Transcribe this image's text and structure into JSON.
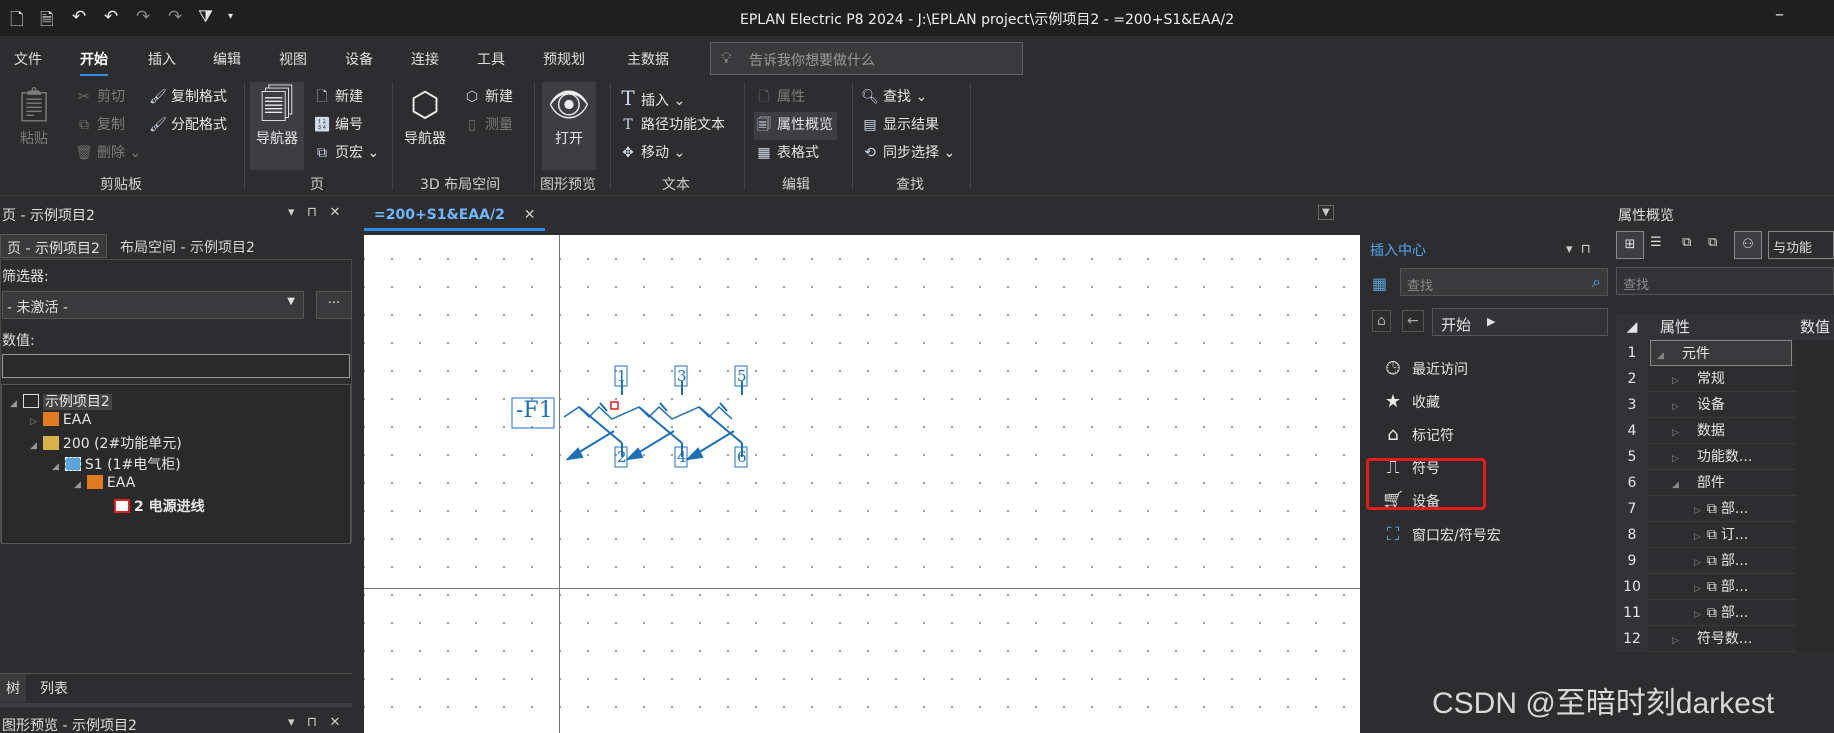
{
  "window": {
    "title": "EPLAN Electric P8 2024 - J:\\EPLAN project\\示例项目2 - =200+S1&EAA/2",
    "minimize": "–"
  },
  "ribbon_tabs": [
    "文件",
    "开始",
    "插入",
    "编辑",
    "视图",
    "设备",
    "连接",
    "工具",
    "预规划",
    "主数据"
  ],
  "active_tab": "开始",
  "tell_me": {
    "placeholder": "告诉我你想要做什么"
  },
  "groups": {
    "clipboard": {
      "label": "剪贴板",
      "paste": "粘贴",
      "cut": "剪切",
      "copy": "复制",
      "delete": "删除",
      "copy_format": "复制格式",
      "distribute_format": "分配格式"
    },
    "page": {
      "label": "页",
      "navigator": "导航器",
      "new": "新建",
      "number": "编号",
      "page_macro": "页宏"
    },
    "layout3d": {
      "label": "3D 布局空间",
      "navigator": "导航器",
      "new": "新建",
      "measure": "测量"
    },
    "preview": {
      "label": "图形预览",
      "open": "打开"
    },
    "text": {
      "label": "文本",
      "insert": "插入",
      "path_text": "路径功能文本",
      "move": "移动"
    },
    "edit": {
      "label": "编辑",
      "properties": "属性",
      "overview": "属性概览",
      "table_format": "表格式"
    },
    "find": {
      "label": "查找",
      "find": "查找",
      "show_results": "显示结果",
      "sync_select": "同步选择"
    }
  },
  "left_panel": {
    "title": "页 - 示例项目2",
    "tabs": [
      "页 - 示例项目2",
      "布局空间 - 示例项目2"
    ],
    "filter_label": "筛选器:",
    "filter_value": "- 未激活 -",
    "filter_more": "...",
    "value_label": "数值:",
    "value_input": "",
    "tree": [
      {
        "label": "示例项目2",
        "level": 0,
        "icon": "project-icon"
      },
      {
        "label": "EAA",
        "level": 1,
        "icon": "location-icon"
      },
      {
        "label": "200 (2#功能单元)",
        "level": 1,
        "icon": "function-icon"
      },
      {
        "label": "S1 (1#电气柜)",
        "level": 2,
        "icon": "cabinet-icon"
      },
      {
        "label": "EAA",
        "level": 3,
        "icon": "location-icon"
      },
      {
        "label": "2 电源进线",
        "level": 4,
        "icon": "page-icon",
        "bold": true
      }
    ],
    "bottom_tabs": [
      "树",
      "列表"
    ],
    "preview_title": "图形预览 - 示例项目2"
  },
  "document_tab": {
    "label": "=200+S1&EAA/2",
    "close": "✕"
  },
  "schematic": {
    "device_tag": "-F1",
    "pins_top": [
      "1",
      "3",
      "5"
    ],
    "pins_bottom": [
      "2",
      "4",
      "6"
    ]
  },
  "insert_center": {
    "title": "插入中心",
    "search_placeholder": "查找",
    "breadcrumb": "开始",
    "items": [
      {
        "label": "最近访问",
        "icon": "clock-icon"
      },
      {
        "label": "收藏",
        "icon": "star-icon"
      },
      {
        "label": "标记符",
        "icon": "tag-icon"
      },
      {
        "label": "符号",
        "icon": "symbol-icon"
      },
      {
        "label": "设备",
        "icon": "cart-icon"
      },
      {
        "label": "窗口宏/符号宏",
        "icon": "macro-icon"
      }
    ]
  },
  "right_panel": {
    "title": "属性概览",
    "func_button": "与功能",
    "search_placeholder": "查找",
    "columns": [
      "属性",
      "数值"
    ],
    "rows": [
      {
        "n": "1",
        "label": "元件",
        "indent": 1,
        "arrow": "◢"
      },
      {
        "n": "2",
        "label": "常规",
        "indent": 2,
        "arrow": "▷"
      },
      {
        "n": "3",
        "label": "设备",
        "indent": 2,
        "arrow": "▷"
      },
      {
        "n": "4",
        "label": "数据",
        "indent": 2,
        "arrow": "▷"
      },
      {
        "n": "5",
        "label": "功能数...",
        "indent": 2,
        "arrow": "▷"
      },
      {
        "n": "6",
        "label": "部件",
        "indent": 2,
        "arrow": "◢"
      },
      {
        "n": "7",
        "label": "部...",
        "indent": 3,
        "arrow": "▷"
      },
      {
        "n": "8",
        "label": "订...",
        "indent": 3,
        "arrow": "▷"
      },
      {
        "n": "9",
        "label": "部...",
        "indent": 3,
        "arrow": "▷"
      },
      {
        "n": "10",
        "label": "部...",
        "indent": 3,
        "arrow": "▷"
      },
      {
        "n": "11",
        "label": "部...",
        "indent": 3,
        "arrow": "▷"
      },
      {
        "n": "12",
        "label": "符号数...",
        "indent": 2,
        "arrow": "▷"
      }
    ]
  },
  "watermark": "CSDN @至暗时刻darkest",
  "colors": {
    "accent": "#2f8ee8",
    "highlight": "#e51c1c",
    "schematic": "#1f6fb5"
  }
}
